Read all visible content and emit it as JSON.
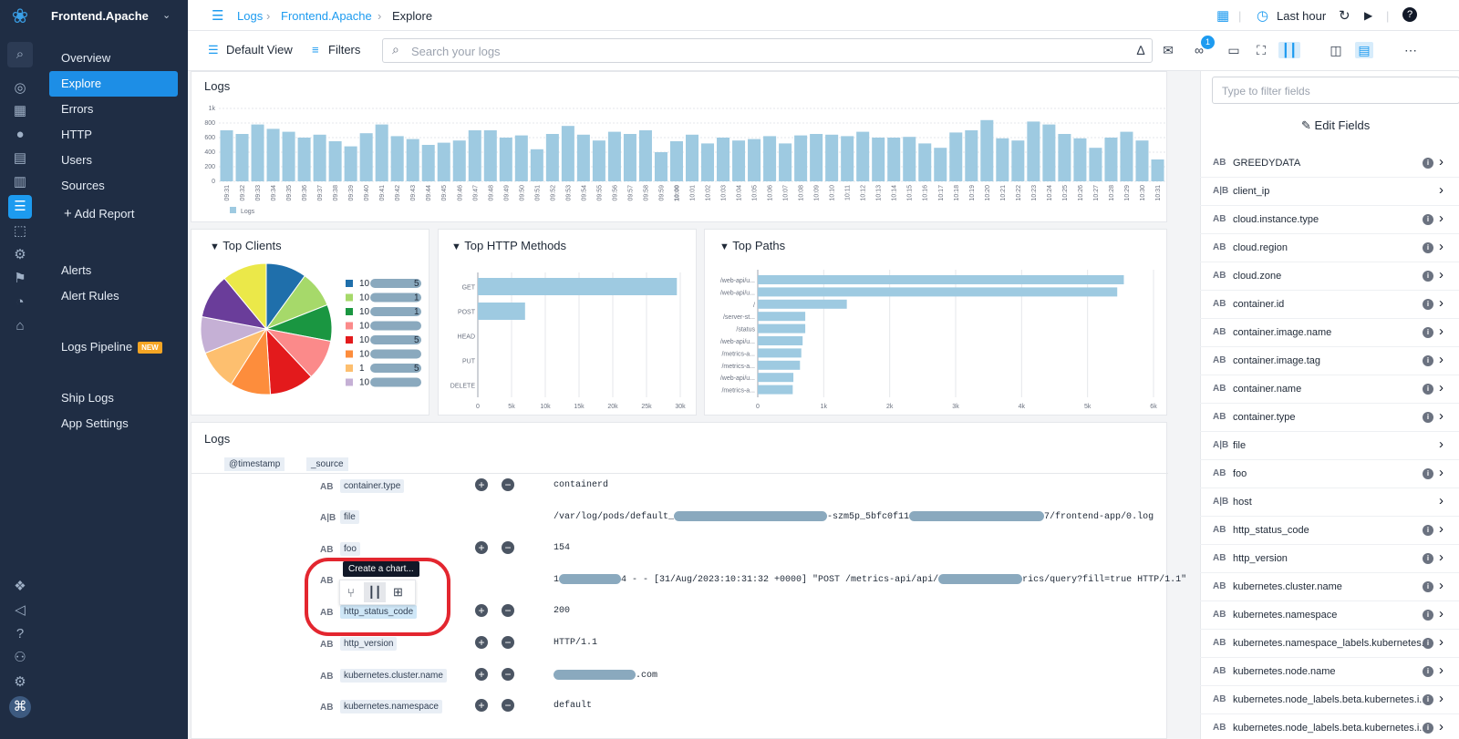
{
  "app": {
    "name": "Frontend.Apache"
  },
  "nav": {
    "items": [
      "Overview",
      "Explore",
      "Errors",
      "HTTP",
      "Users",
      "Sources"
    ],
    "add_report": "Add Report",
    "alerts": "Alerts",
    "alert_rules": "Alert Rules",
    "logs_pipeline": "Logs Pipeline",
    "new_badge": "NEW",
    "ship_logs": "Ship Logs",
    "app_settings": "App Settings",
    "active": "Explore"
  },
  "breadcrumb": [
    "Logs",
    "Frontend.Apache",
    "Explore"
  ],
  "header": {
    "time_range": "Last hour",
    "links_badge": "1"
  },
  "toolbar": {
    "view": "Default View",
    "filters": "Filters",
    "search_placeholder": "Search your logs"
  },
  "histogram": {
    "title": "Logs",
    "legend": "Logs",
    "chart_data": {
      "type": "bar",
      "categories": [
        "09:31",
        "09:32",
        "09:33",
        "09:34",
        "09:35",
        "09:36",
        "09:37",
        "09:38",
        "09:39",
        "09:40",
        "09:41",
        "09:42",
        "09:43",
        "09:44",
        "09:45",
        "09:46",
        "09:47",
        "09:48",
        "09:49",
        "09:50",
        "09:51",
        "09:52",
        "09:53",
        "09:54",
        "09:55",
        "09:56",
        "09:57",
        "09:58",
        "09:59",
        "10:00",
        "10:01",
        "10:02",
        "10:03",
        "10:04",
        "10:05",
        "10:06",
        "10:07",
        "10:08",
        "10:09",
        "10:10",
        "10:11",
        "10:12",
        "10:13",
        "10:14",
        "10:15",
        "10:16",
        "10:17",
        "10:18",
        "10:19",
        "10:20",
        "10:21",
        "10:22",
        "10:23",
        "10:24",
        "10:25",
        "10:26",
        "10:27",
        "10:28",
        "10:29",
        "10:30",
        "10:31"
      ],
      "values": [
        700,
        650,
        780,
        720,
        680,
        600,
        640,
        550,
        480,
        660,
        780,
        620,
        580,
        500,
        530,
        560,
        700,
        700,
        600,
        630,
        440,
        650,
        760,
        640,
        560,
        680,
        650,
        700,
        400,
        550,
        640,
        520,
        600,
        560,
        580,
        620,
        520,
        630,
        650,
        640,
        620,
        680,
        600,
        600,
        610,
        520,
        460,
        670,
        700,
        840,
        590,
        560,
        820,
        780,
        650,
        590,
        460,
        600,
        680,
        560,
        300
      ],
      "yticks": [
        "0",
        "200",
        "400",
        "600",
        "800",
        "1k"
      ],
      "ylim": [
        0,
        1000
      ]
    }
  },
  "top_clients": {
    "title": "Top Clients",
    "chart_data": {
      "type": "pie",
      "labels": [
        "10",
        "10",
        "10",
        "10",
        "10",
        "10",
        "1",
        "10"
      ],
      "values": [
        10,
        9,
        9,
        10,
        11,
        10,
        10,
        9,
        11,
        11
      ],
      "colors": [
        "#1f6fab",
        "#a6d96a",
        "#1a9641",
        "#fb8a8a",
        "#e31a1c",
        "#fd8d3c",
        "#fdbf6f",
        "#c5b0d5",
        "#6a3d9a",
        "#ebe849"
      ]
    },
    "legend_suffix": [
      "5",
      "1",
      "1",
      "",
      "5",
      "",
      "5",
      ""
    ]
  },
  "top_methods": {
    "title": "Top HTTP Methods",
    "chart_data": {
      "type": "bar",
      "orientation": "horizontal",
      "categories": [
        "GET",
        "POST",
        "HEAD",
        "PUT",
        "DELETE"
      ],
      "values": [
        29500,
        7000,
        0,
        0,
        0
      ],
      "xticks": [
        "0",
        "5k",
        "10k",
        "15k",
        "20k",
        "25k",
        "30k"
      ],
      "xlim": [
        0,
        30000
      ]
    }
  },
  "top_paths": {
    "title": "Top Paths",
    "chart_data": {
      "type": "bar",
      "orientation": "horizontal",
      "categories": [
        "/web-api/u...",
        "/web-api/u...",
        "/",
        "/server-st...",
        "/status",
        "/web-api/u...",
        "/metrics-a...",
        "/metrics-a...",
        "/web-api/u...",
        "/metrics-a..."
      ],
      "values": [
        5550,
        5450,
        1350,
        720,
        720,
        680,
        660,
        640,
        540,
        530
      ],
      "xticks": [
        "0",
        "1k",
        "2k",
        "3k",
        "4k",
        "5k",
        "6k"
      ],
      "xlim": [
        0,
        6000
      ]
    }
  },
  "logs_table": {
    "title": "Logs",
    "col_timestamp": "@timestamp",
    "col_source": "_source",
    "rows": [
      {
        "type": "AB",
        "key": "container.type",
        "value": "containerd"
      },
      {
        "type": "A|B",
        "key": "file",
        "value_a": "/var/log/pods/default_",
        "value_b": "-szm5p_5bfc0f11",
        "value_c": "7/frontend-app/0.log"
      },
      {
        "type": "AB",
        "key": "foo",
        "value": "154"
      },
      {
        "type": "AB",
        "key": "",
        "value_a": "1",
        "value_b": "4 - - [31/Aug/2023:10:31:32 +0000] \"POST /metrics-api/api/",
        "value_c": "rics/query?fill=true HTTP/1.1\""
      },
      {
        "type": "AB",
        "key": "http_status_code",
        "value": "200"
      },
      {
        "type": "AB",
        "key": "http_version",
        "value": "HTTP/1.1"
      },
      {
        "type": "AB",
        "key": "kubernetes.cluster.name",
        "value": ".com"
      },
      {
        "type": "AB",
        "key": "kubernetes.namespace",
        "value": "default"
      }
    ],
    "tooltip": "Create a chart..."
  },
  "fields_panel": {
    "filter_placeholder": "Type to filter fields",
    "edit_fields": "Edit Fields",
    "fields": [
      {
        "type": "AB",
        "name": "GREEDYDATA",
        "info": true
      },
      {
        "type": "A|B",
        "name": "client_ip",
        "info": false
      },
      {
        "type": "AB",
        "name": "cloud.instance.type",
        "info": true
      },
      {
        "type": "AB",
        "name": "cloud.region",
        "info": true
      },
      {
        "type": "AB",
        "name": "cloud.zone",
        "info": true
      },
      {
        "type": "AB",
        "name": "container.id",
        "info": true
      },
      {
        "type": "AB",
        "name": "container.image.name",
        "info": true
      },
      {
        "type": "AB",
        "name": "container.image.tag",
        "info": true
      },
      {
        "type": "AB",
        "name": "container.name",
        "info": true
      },
      {
        "type": "AB",
        "name": "container.type",
        "info": true
      },
      {
        "type": "A|B",
        "name": "file",
        "info": false
      },
      {
        "type": "AB",
        "name": "foo",
        "info": true
      },
      {
        "type": "A|B",
        "name": "host",
        "info": false
      },
      {
        "type": "AB",
        "name": "http_status_code",
        "info": true
      },
      {
        "type": "AB",
        "name": "http_version",
        "info": true
      },
      {
        "type": "AB",
        "name": "kubernetes.cluster.name",
        "info": true
      },
      {
        "type": "AB",
        "name": "kubernetes.namespace",
        "info": true
      },
      {
        "type": "AB",
        "name": "kubernetes.namespace_labels.kubernetes...",
        "info": true
      },
      {
        "type": "AB",
        "name": "kubernetes.node.name",
        "info": true
      },
      {
        "type": "AB",
        "name": "kubernetes.node_labels.beta.kubernetes.i...",
        "info": true
      },
      {
        "type": "AB",
        "name": "kubernetes.node_labels.beta.kubernetes.i...",
        "info": true
      }
    ]
  },
  "colors": {
    "accent": "#1d9bf0",
    "nav_bg": "#1f2d44",
    "bar": "#9ecae1",
    "highlight": "#e3262f"
  }
}
